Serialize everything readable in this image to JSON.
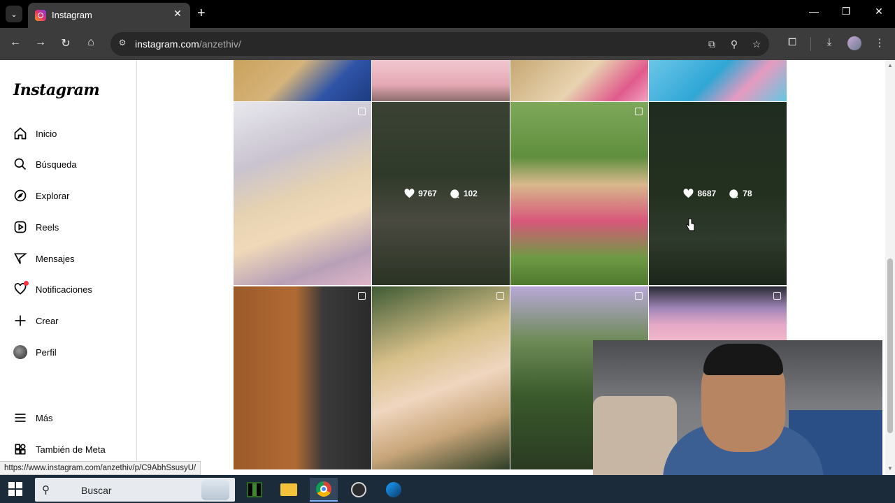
{
  "browser": {
    "tab_title": "Instagram",
    "url_host": "instagram.com",
    "url_path": "/anzethiv/",
    "status_url": "https://www.instagram.com/anzethiv/p/C9AbhSsusyU/"
  },
  "sidebar": {
    "logo": "Instagram",
    "items": [
      {
        "label": "Inicio",
        "icon": "home-icon"
      },
      {
        "label": "Búsqueda",
        "icon": "search-icon"
      },
      {
        "label": "Explorar",
        "icon": "compass-icon"
      },
      {
        "label": "Reels",
        "icon": "reels-icon"
      },
      {
        "label": "Mensajes",
        "icon": "send-icon"
      },
      {
        "label": "Notificaciones",
        "icon": "heart-icon"
      },
      {
        "label": "Crear",
        "icon": "plus-icon"
      },
      {
        "label": "Perfil",
        "icon": "avatar"
      },
      {
        "label": "Más",
        "icon": "menu-icon"
      },
      {
        "label": "También de Meta",
        "icon": "meta-grid-icon"
      }
    ]
  },
  "grid": {
    "hover_posts": [
      {
        "likes": "9767",
        "comments": "102"
      },
      {
        "likes": "8687",
        "comments": "78"
      }
    ]
  },
  "taskbar": {
    "search_placeholder": "Buscar"
  },
  "colors": {
    "notification_dot": "#ff3040",
    "taskbar_bg": "#1c2b3a",
    "chrome_bg": "#3c3c3c"
  }
}
